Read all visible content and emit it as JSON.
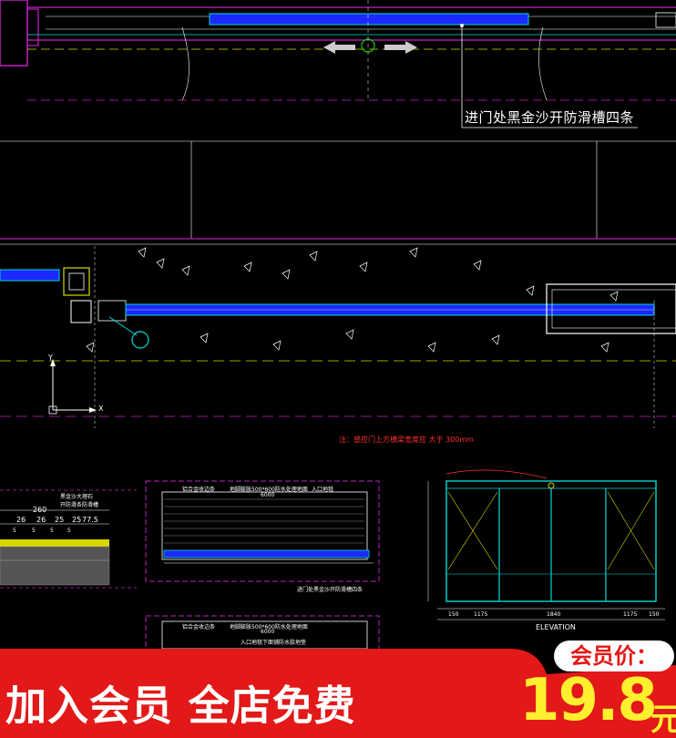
{
  "drawing": {
    "main_annotation": "进门处黑金沙开防滑槽四条",
    "red_note": "注：感应门上方横梁宽度应 大于 300mm",
    "axis_labels": {
      "x": "X",
      "y": "Y"
    },
    "detail_section": {
      "label_line1": "黑金沙大理石",
      "label_line2": "开防滑条防滑槽",
      "dims_top": "260",
      "dims_row": [
        "26",
        "26",
        "25",
        "25",
        "77.5"
      ],
      "dims_small": [
        "5",
        "5",
        "5",
        "5"
      ]
    },
    "plan_detail_1": {
      "labels": [
        "铝合金收边条",
        "地脚膨胀500*600防水处理地面",
        "入口地毯"
      ],
      "dim": "6000",
      "bottom_note": "进门处黑金沙开防滑槽四条"
    },
    "plan_detail_2": {
      "labels": [
        "铝合金收边条",
        "地脚膨胀500*600防水处理地面",
        "入口地毯下面铺防水胶地垫",
        "6000"
      ]
    },
    "door_elevation": {
      "bottom_dims": [
        "150",
        "1175",
        "1840",
        "1175",
        "150"
      ],
      "title": "ELEVATION"
    }
  },
  "promo": {
    "banner_text": "加入会员 全店免费",
    "badge": "会员价：",
    "price": "19.8",
    "unit": "元"
  },
  "colors": {
    "background": "#000000",
    "cad_magenta": "#c020c0",
    "cad_yellow": "#d8d800",
    "cad_cyan": "#00d8d8",
    "cad_blue": "#2030ff",
    "banner_red": "#e31818",
    "price_yellow": "#ffef2e"
  }
}
